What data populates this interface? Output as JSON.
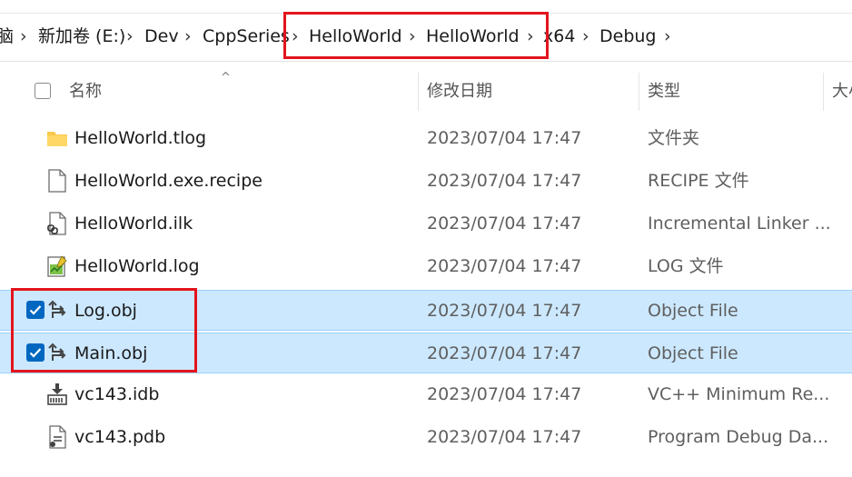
{
  "breadcrumb": {
    "items": [
      "脑",
      "新加卷 (E:)",
      "Dev",
      "CppSeries",
      "HelloWorld",
      "HelloWorld",
      "x64",
      "Debug"
    ]
  },
  "columns": {
    "name": "名称",
    "modified": "修改日期",
    "type": "类型",
    "size": "大小"
  },
  "files": [
    {
      "name": "HelloWorld.tlog",
      "date": "2023/07/04 17:47",
      "type": "文件夹",
      "icon": "folder-icon",
      "selected": false
    },
    {
      "name": "HelloWorld.exe.recipe",
      "date": "2023/07/04 17:47",
      "type": "RECIPE 文件",
      "icon": "file-icon",
      "selected": false
    },
    {
      "name": "HelloWorld.ilk",
      "date": "2023/07/04 17:47",
      "type": "Incremental Linker ...",
      "icon": "linker-file-icon",
      "selected": false
    },
    {
      "name": "HelloWorld.log",
      "date": "2023/07/04 17:47",
      "type": "LOG 文件",
      "icon": "log-file-icon",
      "selected": false
    },
    {
      "name": "Log.obj",
      "date": "2023/07/04 17:47",
      "type": "Object File",
      "icon": "object-file-icon",
      "selected": true
    },
    {
      "name": "Main.obj",
      "date": "2023/07/04 17:47",
      "type": "Object File",
      "icon": "object-file-icon",
      "selected": true
    },
    {
      "name": "vc143.idb",
      "date": "2023/07/04 17:47",
      "type": "VC++ Minimum Re...",
      "icon": "idb-file-icon",
      "selected": false
    },
    {
      "name": "vc143.pdb",
      "date": "2023/07/04 17:47",
      "type": "Program Debug Da...",
      "icon": "pdb-file-icon",
      "selected": false
    }
  ],
  "colors": {
    "selection_bg": "#cce8ff",
    "checkbox": "#0067c0",
    "highlight_box": "#e3141d"
  }
}
